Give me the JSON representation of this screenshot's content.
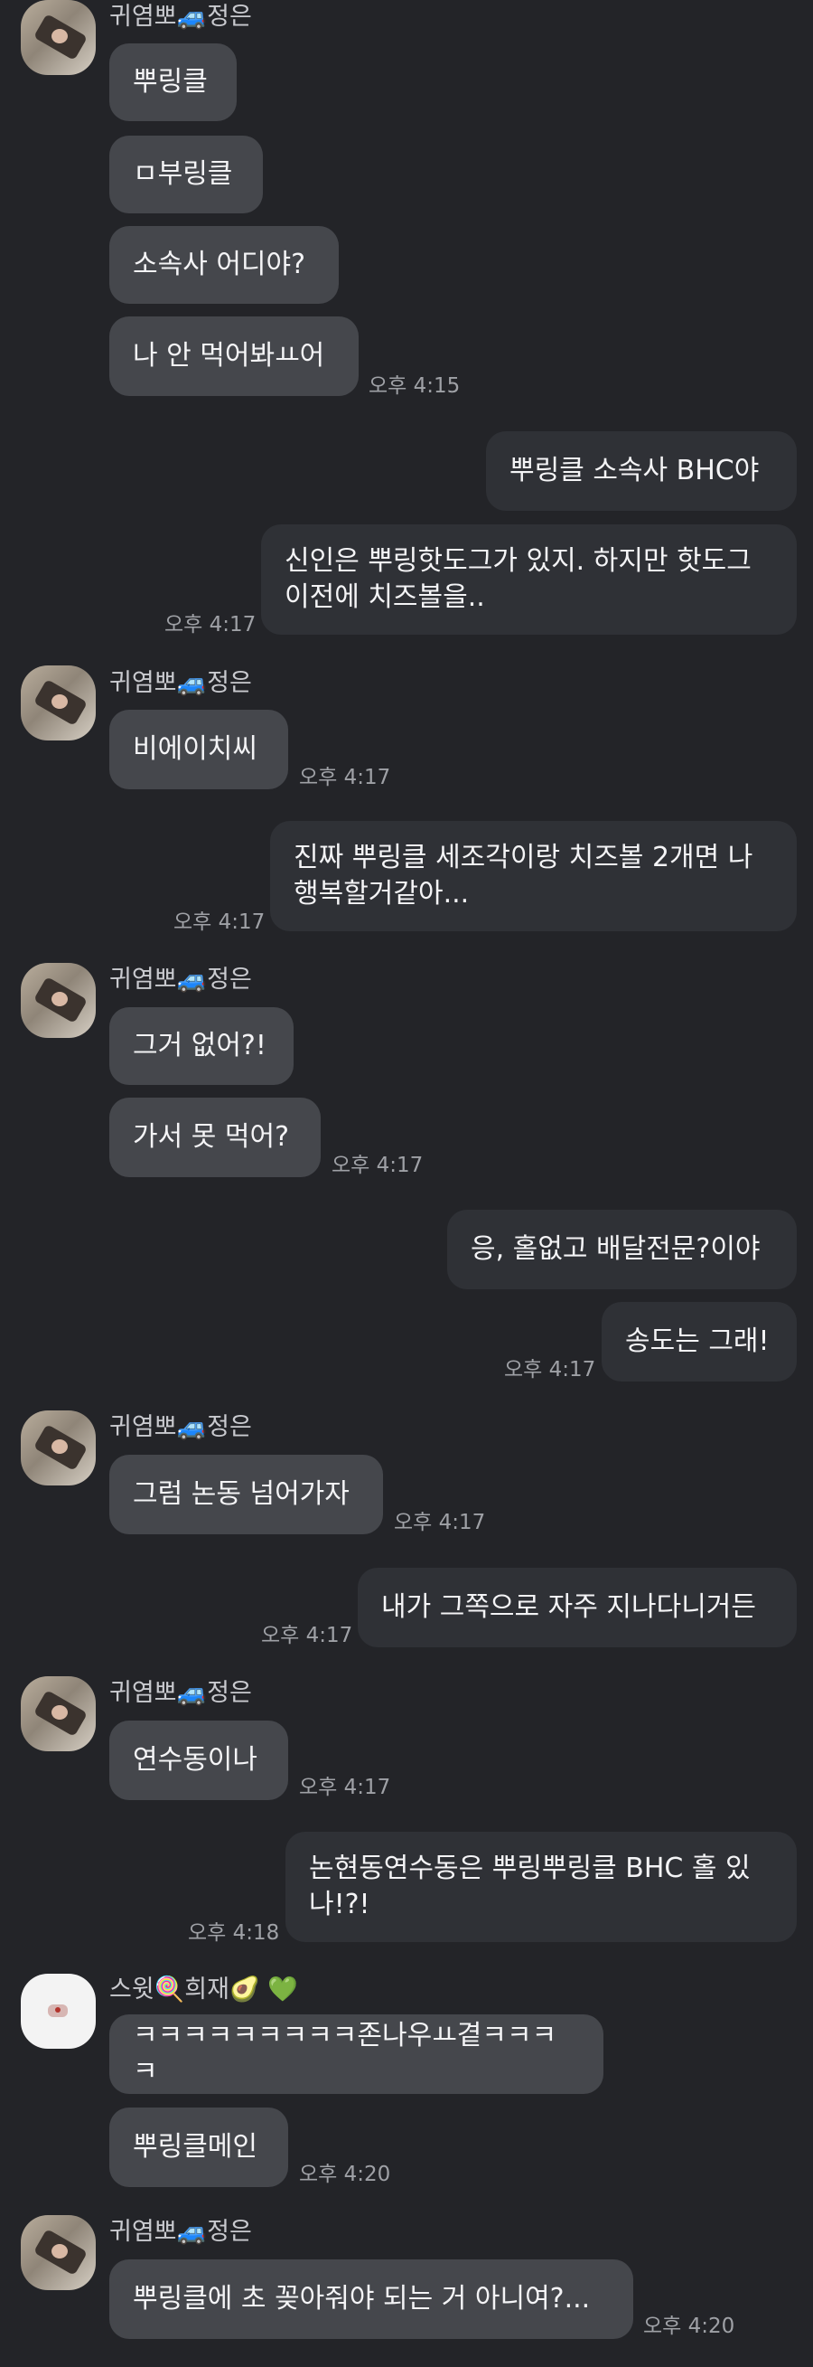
{
  "accent_colors": {
    "background": "#232428",
    "incoming_bubble": "#45474c",
    "outgoing_bubble": "#2f3136"
  },
  "senders": {
    "jeongeun": "귀염뽀🚙정은",
    "huijae": "스윗🍭희재🥑 💚"
  },
  "messages": {
    "m1": "뿌링클",
    "m2": "ㅁ부링클",
    "m3": "소속사 어디야?",
    "m4": "나 안 먹어봐ㅛ어",
    "m5": "뿌링클 소속사 BHC야",
    "m6": "신인은 뿌링핫도그가 있지. 하지만 핫도그\n이전에 치즈볼을..",
    "m7": "비에이치씨",
    "m8": "진짜 뿌링클 세조각이랑 치즈볼 2개면 나\n행복할거같아...",
    "m9": "그거 없어?!",
    "m10": "가서 못 먹어?",
    "m11": "응, 홀없고 배달전문?이야",
    "m12": "송도는 그래!",
    "m13": "그럼 논동 넘어가자",
    "m14": "내가 그쪽으로 자주 지나다니거든",
    "m15": "연수동이나",
    "m16": "논현동연수동은 뿌링뿌링클 BHC 홀 있\n나!?!",
    "m17": "ㅋㅋㅋㅋㅋㅋㅋㅋㅋ존나우ㅛ곁ㅋㅋㅋㅋ",
    "m18": "뿌링클메인",
    "m19": "뿌링클에 초 꽂아줘야 되는 거 아니여?..."
  },
  "times": {
    "t1": "오후 4:15",
    "t2": "오후 4:17",
    "t3": "오후 4:17",
    "t4": "오후 4:17",
    "t5": "오후 4:17",
    "t6": "오후 4:17",
    "t7": "오후 4:17",
    "t8": "오후 4:17",
    "t9": "오후 4:17",
    "t10": "오후 4:18",
    "t11": "오후 4:20",
    "t12": "오후 4:20"
  }
}
